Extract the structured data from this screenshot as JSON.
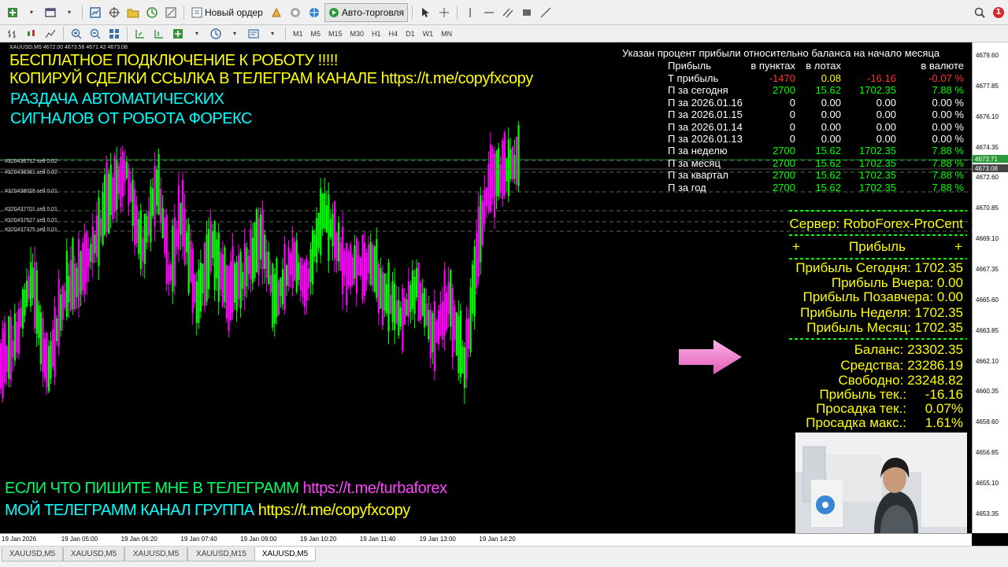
{
  "toolbar": {
    "new_order_label": "Новый ордер",
    "autotrading_label": "Авто-торговля",
    "timeframes": [
      "M1",
      "M5",
      "M15",
      "M30",
      "H1",
      "H4",
      "D1",
      "W1",
      "MN"
    ],
    "notification_count": "1"
  },
  "chart": {
    "info_line": "XAUUSD,M5  4672.00 4673.56 4671.42 4673.08",
    "bull_color": "#00ff00",
    "bear_color": "#ff00ff"
  },
  "promo": {
    "line1": "БЕСПЛАТНОЕ ПОДКЛЮЧЕНИЕ К РОБОТУ !!!!!",
    "line2": "КОПИРУЙ СДЕЛКИ ССЫЛКА В ТЕЛЕГРАМ КАНАЛЕ https://t.me/copyfxcopy",
    "line3": "РАЗДАЧА АВТОМАТИЧЕСКИХ",
    "line4": "СИГНАЛОВ ОТ РОБОТА ФОРЕКС",
    "bottom1_text": "ЕСЛИ ЧТО ПИШИТЕ МНЕ В ТЕЛЕГРАММ",
    "bottom1_link": "https://t.me/turbaforex",
    "bottom2_text": "МОЙ ТЕЛЕГРАММ КАНАЛ ГРУППА",
    "bottom2_link": "https://t.me/copyfxcopy"
  },
  "orders": [
    "#320438712 sell 0.02",
    "#320438361 sell 0.02",
    "#320438028 sell 0.01",
    "#320437701 sell 0.01",
    "#320437627 sell 0.01",
    "#320437375 sell 0.01"
  ],
  "stats": {
    "header_note": "Указан процент прибыли относительно баланса на начало месяца",
    "columns": [
      "Прибыль",
      "в пунктах",
      "в лотах",
      "",
      "в валюте"
    ],
    "rows": [
      {
        "label": "Т прибыль",
        "points": "-1470",
        "lots": "0.08",
        "money": "-16.16",
        "pct": "-0.07 %",
        "neg": true
      },
      {
        "label": "П за сегодня",
        "points": "2700",
        "lots": "15.62",
        "money": "1702.35",
        "pct": "7.88 %",
        "neg": false
      },
      {
        "label": "П за 2026.01.16",
        "points": "0",
        "lots": "0.00",
        "money": "0.00",
        "pct": "0.00 %",
        "zero": true
      },
      {
        "label": "П за 2026.01.15",
        "points": "0",
        "lots": "0.00",
        "money": "0.00",
        "pct": "0.00 %",
        "zero": true
      },
      {
        "label": "П за 2026.01.14",
        "points": "0",
        "lots": "0.00",
        "money": "0.00",
        "pct": "0.00 %",
        "zero": true
      },
      {
        "label": "П за 2026.01.13",
        "points": "0",
        "lots": "0.00",
        "money": "0.00",
        "pct": "0.00 %",
        "zero": true
      },
      {
        "label": "П за неделю",
        "points": "2700",
        "lots": "15.62",
        "money": "1702.35",
        "pct": "7.88 %",
        "neg": false
      },
      {
        "label": "П за месяц",
        "points": "2700",
        "lots": "15.62",
        "money": "1702.35",
        "pct": "7.88 %",
        "neg": false
      },
      {
        "label": "П за квартал",
        "points": "2700",
        "lots": "15.62",
        "money": "1702.35",
        "pct": "7.88 %",
        "neg": false
      },
      {
        "label": "П за год",
        "points": "2700",
        "lots": "15.62",
        "money": "1702.35",
        "pct": "7.88 %",
        "neg": false
      }
    ]
  },
  "account": {
    "server": "Сервер: RoboForex-ProCent",
    "plus": "+",
    "profit_header": "Прибыль",
    "profit_today": "Прибыль Сегодня: 1702.35",
    "profit_yesterday": "Прибыль Вчера: 0.00",
    "profit_before_yesterday": "Прибыль Позавчера: 0.00",
    "profit_week": "Прибыль Неделя: 1702.35",
    "profit_month": "Прибыль Месяц: 1702.35",
    "balance": "Баланс: 23302.35",
    "equity": "Средства: 23286.19",
    "free": "Свободно: 23248.82",
    "profit_current_label": "Прибыль тек.:",
    "profit_current_value": "-16.16",
    "drawdown_current_label": "Просадка тек.:",
    "drawdown_current_value": "0.07%",
    "drawdown_max_label": "Просадка макс.:",
    "drawdown_max_value": "1.61%"
  },
  "price_axis": {
    "labels": [
      "4679.60",
      "4677.85",
      "4676.10",
      "4674.35",
      "4672.60",
      "4670.85",
      "4669.10",
      "4667.35",
      "4665.60",
      "4663.85",
      "4662.10",
      "4660.35",
      "4658.60",
      "4656.85",
      "4655.10",
      "4653.35"
    ],
    "bid_marker": "4673.08",
    "ask_marker": "4673.71"
  },
  "time_axis": {
    "labels": [
      "19 Jan 2026",
      "19 Jan 05:00",
      "19 Jan 06:20",
      "19 Jan 07:40",
      "19 Jan 09:00",
      "19 Jan 10:20",
      "19 Jan 11:40",
      "19 Jan 13:00",
      "19 Jan 14:20"
    ]
  },
  "tabs": [
    "XAUUSD,M5",
    "XAUUSD,M5",
    "XAUUSD,M5",
    "XAUUSD,M15",
    "XAUUSD,M5"
  ],
  "active_tab": 4
}
